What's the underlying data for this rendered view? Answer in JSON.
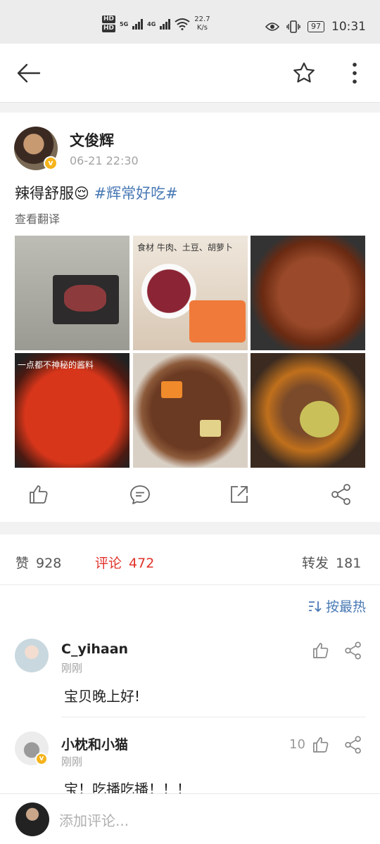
{
  "statusbar": {
    "hd1": "HD",
    "hd2": "HD",
    "net1": "5G",
    "net2": "4G",
    "speed_value": "22.7",
    "speed_unit": "K/s",
    "battery": "97",
    "time": "10:31"
  },
  "post": {
    "author": "文俊辉",
    "verified_mark": "v",
    "time": "06-21 22:30",
    "text": "辣得舒服😌 ",
    "hashtag": "#辉常好吃#",
    "translate": "查看翻译",
    "photo_captions": {
      "p2": "食材  牛肉、土豆、胡萝卜",
      "p4": "一点都不神秘的酱料"
    }
  },
  "stats": {
    "likes_label": "赞",
    "likes_count": "928",
    "comments_label": "评论",
    "comments_count": "472",
    "reposts_label": "转发",
    "reposts_count": "181"
  },
  "sort": {
    "label": "按最热"
  },
  "comments": [
    {
      "name": "C_yihaan",
      "time": "刚刚",
      "text": "宝贝晚上好!",
      "likes": ""
    },
    {
      "name": "小枕和小猫",
      "time": "刚刚",
      "text": "宝！吃播吃播！！！",
      "likes": "10"
    }
  ],
  "input": {
    "placeholder": "添加评论..."
  },
  "colors": {
    "accent_red": "#e0322a",
    "link_blue": "#4a7ab5"
  }
}
